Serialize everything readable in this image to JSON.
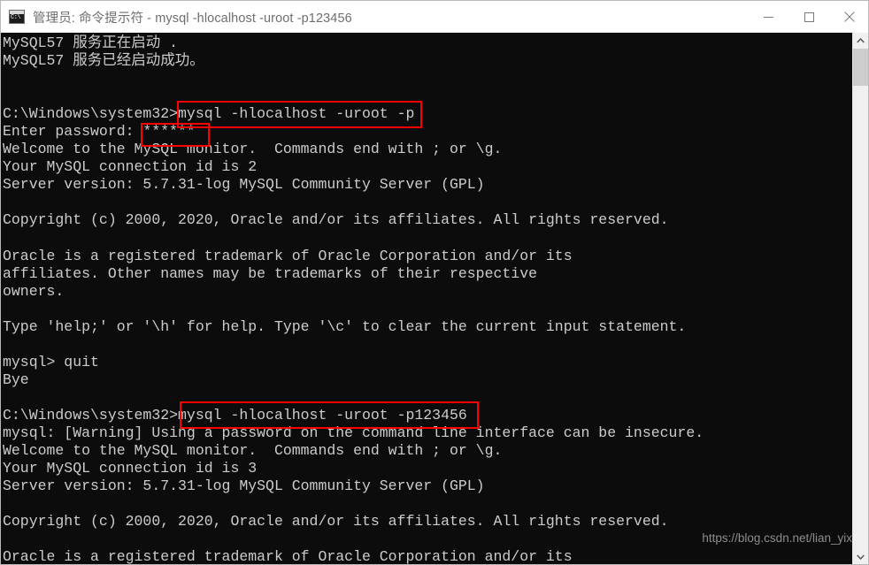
{
  "window": {
    "title": "管理员: 命令提示符 - mysql  -hlocalhost -uroot -p123456",
    "icon_name": "cmd-console-icon",
    "controls": {
      "minimize_label": "最小化",
      "maximize_label": "最大化",
      "close_label": "关闭"
    }
  },
  "console": {
    "background_color": "#0c0c0c",
    "text_color": "#cccccc",
    "lines": [
      "MySQL57 服务正在启动 .",
      "MySQL57 服务已经启动成功。",
      "",
      "",
      "C:\\Windows\\system32>mysql -hlocalhost -uroot -p",
      "Enter password: ******",
      "Welcome to the MySQL monitor.  Commands end with ; or \\g.",
      "Your MySQL connection id is 2",
      "Server version: 5.7.31-log MySQL Community Server (GPL)",
      "",
      "Copyright (c) 2000, 2020, Oracle and/or its affiliates. All rights reserved.",
      "",
      "Oracle is a registered trademark of Oracle Corporation and/or its",
      "affiliates. Other names may be trademarks of their respective",
      "owners.",
      "",
      "Type 'help;' or '\\h' for help. Type '\\c' to clear the current input statement.",
      "",
      "mysql> quit",
      "Bye",
      "",
      "C:\\Windows\\system32>mysql -hlocalhost -uroot -p123456",
      "mysql: [Warning] Using a password on the command line interface can be insecure.",
      "Welcome to the MySQL monitor.  Commands end with ; or \\g.",
      "Your MySQL connection id is 3",
      "Server version: 5.7.31-log MySQL Community Server (GPL)",
      "",
      "Copyright (c) 2000, 2020, Oracle and/or its affiliates. All rights reserved.",
      "",
      "Oracle is a registered trademark of Oracle Corporation and/or its"
    ]
  },
  "annotations": {
    "color": "#fe0000",
    "boxes": [
      {
        "name": "highlight-first-mysql-command",
        "text": "mysql -hlocalhost -uroot -p"
      },
      {
        "name": "highlight-password-mask",
        "text": "******"
      },
      {
        "name": "highlight-second-mysql-command",
        "text": "mysql -hlocalhost -uroot -p123456"
      }
    ]
  },
  "scrollbar": {
    "up_arrow_icon": "chevron-up-icon",
    "down_arrow_icon": "chevron-down-icon"
  },
  "watermark": {
    "text": "https://blog.csdn.net/lian_yix"
  }
}
